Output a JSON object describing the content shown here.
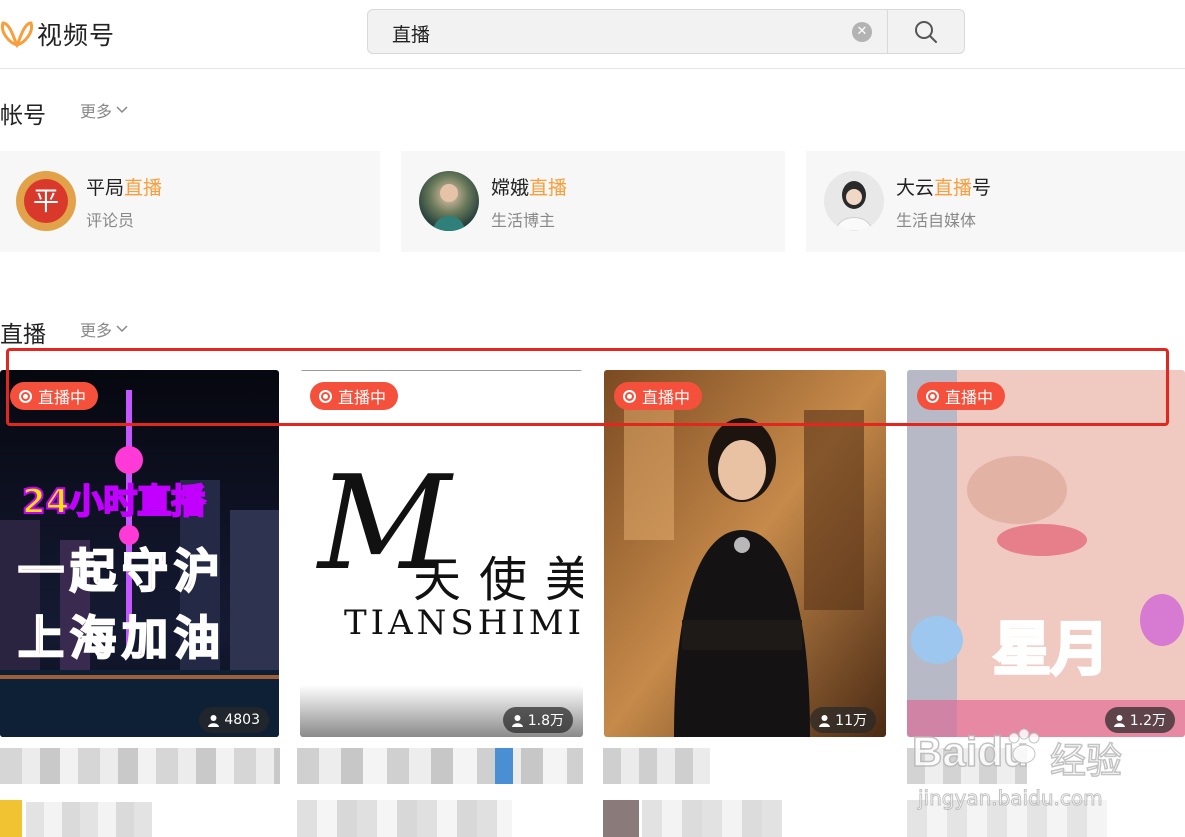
{
  "header": {
    "app_name": "视频号",
    "search": {
      "value": "直播"
    }
  },
  "accounts_section": {
    "title": "帐号",
    "more": "更多",
    "cards": [
      {
        "name_prefix": "平局",
        "name_highlight": "直播",
        "name_suffix": "",
        "role": "评论员"
      },
      {
        "name_prefix": "嫦娥",
        "name_highlight": "直播",
        "name_suffix": "",
        "role": "生活博主"
      },
      {
        "name_prefix": "大云",
        "name_highlight": "直播",
        "name_suffix": "号",
        "role": "生活自媒体"
      }
    ]
  },
  "live_section": {
    "title": "直播",
    "more": "更多",
    "cards": [
      {
        "status": "直播中",
        "viewers": "4803",
        "overlay_lines": [
          "24小时直播",
          "一起守沪",
          "上海加油"
        ]
      },
      {
        "status": "直播中",
        "viewers": "1.8万",
        "brand_cn": "天使美",
        "brand_en": "TIANSHIMI",
        "brand_mark": "M"
      },
      {
        "status": "直播中",
        "viewers": "11万"
      },
      {
        "status": "直播中",
        "viewers": "1.2万",
        "overlay_text": "星月"
      }
    ]
  },
  "watermark": {
    "brand": "Baidu",
    "cn": "经验",
    "url": "jingyan.baidu.com"
  },
  "colors": {
    "accent": "#fa9d3b",
    "live_badge": "#f5503c",
    "highlight_box": "#e3271e"
  }
}
